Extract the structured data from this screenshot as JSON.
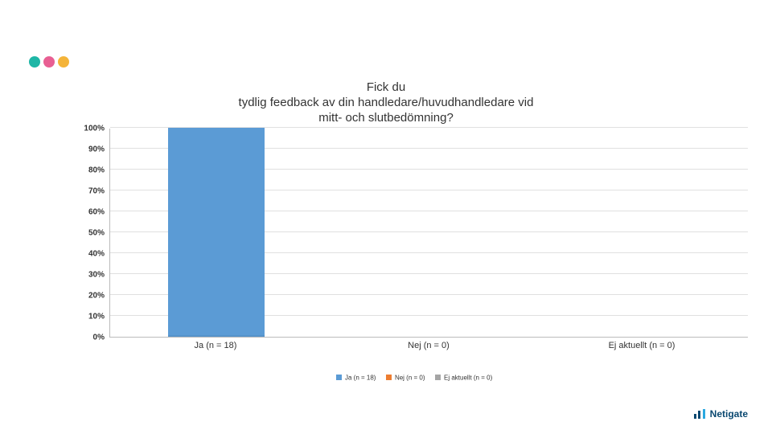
{
  "title_line1": "Fick du",
  "title_line2": "tydlig feedback av din handledare/huvudhandledare vid",
  "title_line3": "mitt- och slutbedömning?",
  "brand": "Netigate",
  "chart_data": {
    "type": "bar",
    "title": "Fick du tydlig feedback av din handledare/huvudhandledare vid mitt- och slutbedömning?",
    "xlabel": "",
    "ylabel": "",
    "ylim": [
      0,
      100
    ],
    "yticks": [
      "0%",
      "10%",
      "20%",
      "30%",
      "40%",
      "50%",
      "60%",
      "70%",
      "80%",
      "90%",
      "100%"
    ],
    "categories": [
      "Ja (n = 18)",
      "Nej (n = 0)",
      "Ej aktuellt (n = 0)"
    ],
    "values": [
      100,
      0,
      0
    ],
    "colors": [
      "#5b9bd5",
      "#ed7d31",
      "#a5a5a5"
    ],
    "legend": [
      "Ja (n = 18)",
      "Nej (n = 0)",
      "Ej aktuellt (n = 0)"
    ]
  }
}
